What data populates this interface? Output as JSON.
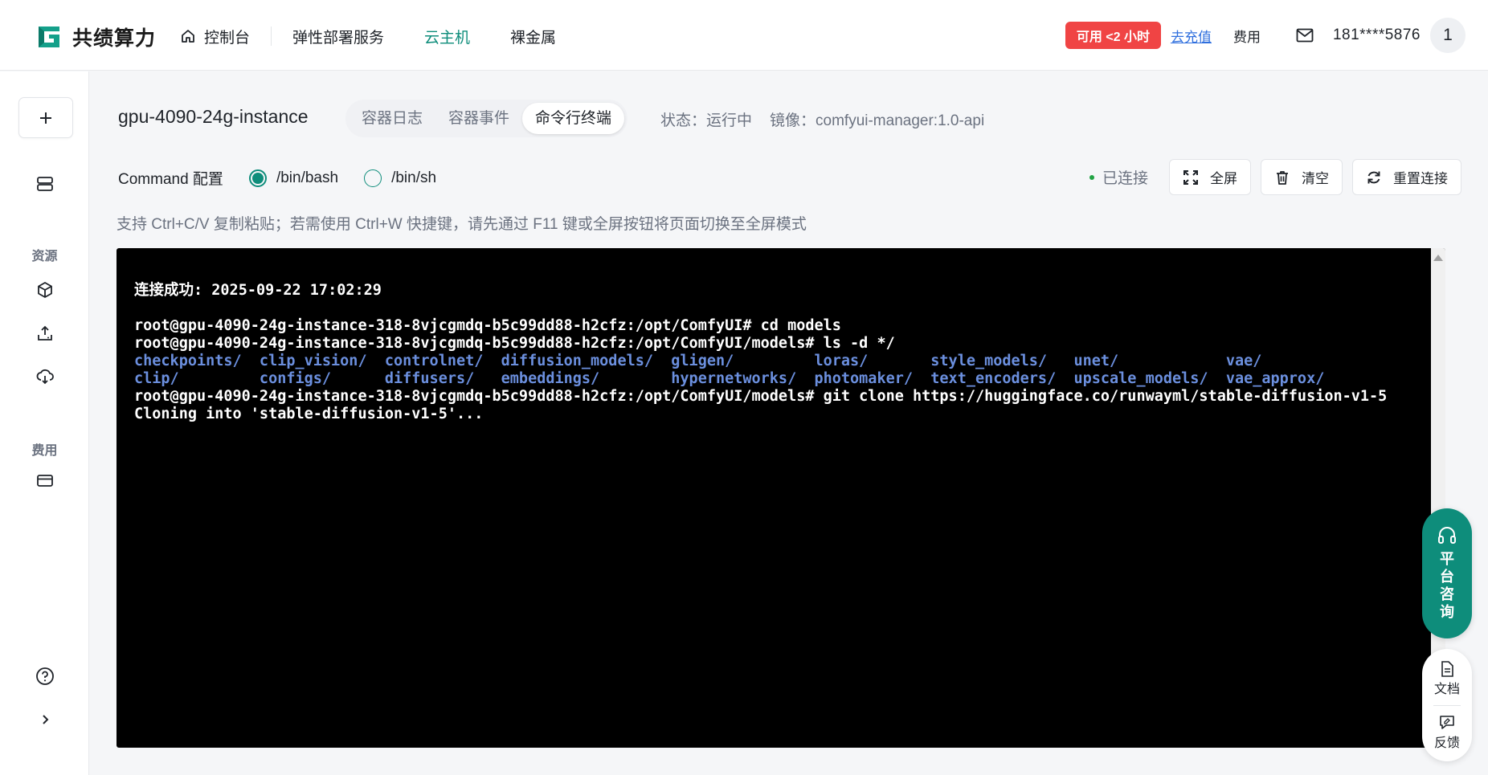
{
  "header": {
    "brand": "共绩算力",
    "nav": [
      {
        "label": "控制台",
        "icon": "home-icon"
      },
      {
        "label": "弹性部署服务"
      },
      {
        "label": "云主机",
        "active": true
      },
      {
        "label": "裸金属"
      }
    ],
    "availability_badge": "可用 <2 小时",
    "recharge_link": "去充值",
    "fee_link": "费用",
    "phone": "181****5876",
    "avatar": "1"
  },
  "sidebar": {
    "section_resources": "资源",
    "section_fees": "费用"
  },
  "instance": {
    "name": "gpu-4090-24g-instance",
    "tabs": [
      "容器日志",
      "容器事件",
      "命令行终端"
    ],
    "active_tab": "命令行终端",
    "status_label": "状态：运行中",
    "image_label": "镜像：comfyui-manager:1.0-api"
  },
  "command": {
    "label": "Command 配置",
    "options": [
      "/bin/bash",
      "/bin/sh"
    ],
    "selected": "/bin/bash"
  },
  "actions": {
    "status": "已连接",
    "fullscreen": "全屏",
    "clear": "清空",
    "reconnect": "重置连接"
  },
  "hint": "支持 Ctrl+C/V 复制粘贴；若需使用 Ctrl+W 快捷键，请先通过 F11 键或全屏按钮将页面切换至全屏模式",
  "terminal": {
    "connected_line": "连接成功: 2025-09-22 17:02:29",
    "line1": "root@gpu-4090-24g-instance-318-8vjcgmdq-b5c99dd88-h2cfz:/opt/ComfyUI# cd models",
    "line2": "root@gpu-4090-24g-instance-318-8vjcgmdq-b5c99dd88-h2cfz:/opt/ComfyUI/models# ls -d */",
    "dirs_row1": "checkpoints/  clip_vision/  controlnet/  diffusion_models/  gligen/         loras/       style_models/   unet/            vae/",
    "dirs_row2": "clip/         configs/      diffusers/   embeddings/        hypernetworks/  photomaker/  text_encoders/  upscale_models/  vae_approx/",
    "line3": "root@gpu-4090-24g-instance-318-8vjcgmdq-b5c99dd88-h2cfz:/opt/ComfyUI/models# git clone https://huggingface.co/runwayml/stable-diffusion-v1-5",
    "line4": "Cloning into 'stable-diffusion-v1-5'..."
  },
  "float": {
    "consult": "平台咨询",
    "docs": "文档",
    "feedback": "反馈"
  },
  "colors": {
    "accent": "#0e8d7b",
    "badge": "#f04444",
    "link": "#2f6fde",
    "dir_blue": "#6b8fde"
  }
}
